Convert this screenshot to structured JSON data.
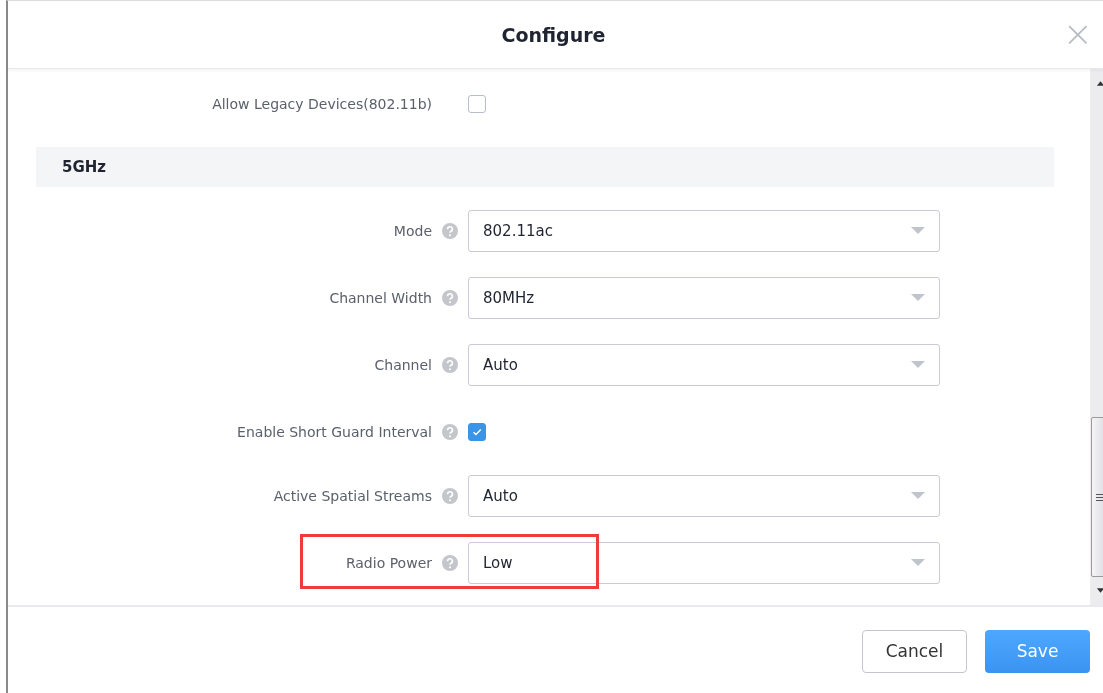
{
  "dialog": {
    "title": "Configure",
    "close": "×"
  },
  "fields": [
    {
      "kind": "checkbox",
      "label": "Allow Legacy Devices(802.11b)",
      "help": false,
      "checked": false
    },
    {
      "kind": "section",
      "label": "5GHz"
    },
    {
      "kind": "select",
      "label": "Mode",
      "help": true,
      "value": "802.11ac",
      "highlighted": false
    },
    {
      "kind": "select",
      "label": "Channel Width",
      "help": true,
      "value": "80MHz",
      "highlighted": false
    },
    {
      "kind": "select",
      "label": "Channel",
      "help": true,
      "value": "Auto",
      "highlighted": false
    },
    {
      "kind": "checkbox",
      "label": "Enable Short Guard Interval",
      "help": true,
      "checked": true
    },
    {
      "kind": "select",
      "label": "Active Spatial Streams",
      "help": true,
      "value": "Auto",
      "highlighted": false
    },
    {
      "kind": "select",
      "label": "Radio Power",
      "help": true,
      "value": "Low",
      "highlighted": true
    }
  ],
  "buttons": [
    {
      "label": "Cancel",
      "kind": "secondary"
    },
    {
      "label": "Save",
      "kind": "primary"
    }
  ]
}
